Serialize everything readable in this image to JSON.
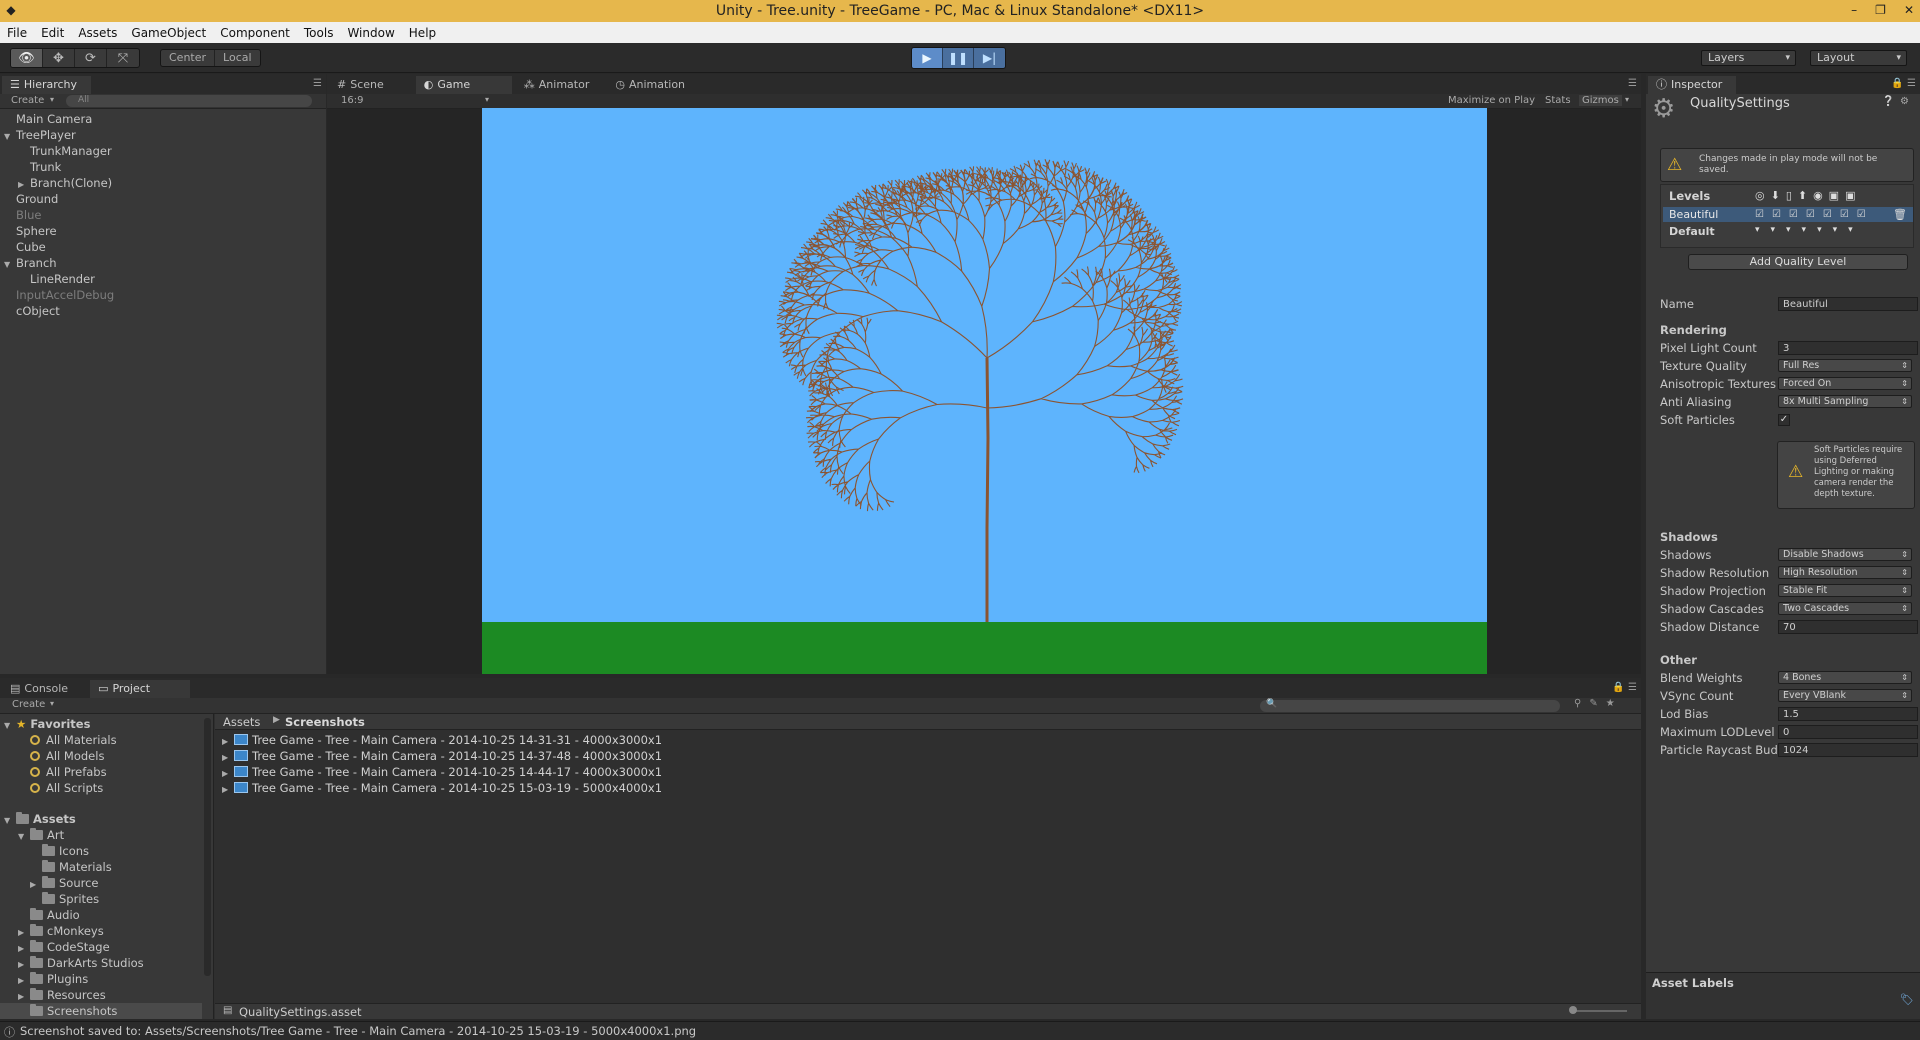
{
  "window": {
    "title": "Unity - Tree.unity - TreeGame - PC, Mac & Linux Standalone* <DX11>"
  },
  "menu": [
    "File",
    "Edit",
    "Assets",
    "GameObject",
    "Component",
    "Tools",
    "Window",
    "Help"
  ],
  "toolbar": {
    "center_label": "Center",
    "local_label": "Local",
    "layers_label": "Layers",
    "layout_label": "Layout"
  },
  "hierarchy": {
    "tab_label": "Hierarchy",
    "create_label": "Create",
    "search_placeholder": "All",
    "items": [
      {
        "label": "Main Camera"
      },
      {
        "label": "TreePlayer"
      },
      {
        "label": "TrunkManager"
      },
      {
        "label": "Trunk"
      },
      {
        "label": "Branch(Clone)"
      },
      {
        "label": "Ground"
      },
      {
        "label": "Blue"
      },
      {
        "label": "Sphere"
      },
      {
        "label": "Cube"
      },
      {
        "label": "Branch"
      },
      {
        "label": "LineRender"
      },
      {
        "label": "InputAccelDebug"
      },
      {
        "label": "cObject"
      }
    ]
  },
  "scene_tabs": [
    {
      "label": "Scene"
    },
    {
      "label": "Game"
    },
    {
      "label": "Animator"
    },
    {
      "label": "Animation"
    }
  ],
  "game_view": {
    "aspect": "16:9",
    "maximize_label": "Maximize on Play",
    "stats_label": "Stats",
    "gizmos_label": "Gizmos",
    "sky_color": "#5eb4fd",
    "ground_color": "#1c8a23",
    "branch_color": "#8b5431"
  },
  "inspector": {
    "tab_label": "Inspector",
    "title": "QualitySettings",
    "warning": "Changes made in play mode will not be saved.",
    "levels_label": "Levels",
    "level_name": "Beautiful",
    "default_label": "Default",
    "add_button": "Add Quality Level",
    "name_label": "Name",
    "name_value": "Beautiful",
    "rendering_header": "Rendering",
    "rendering": [
      {
        "label": "Pixel Light Count",
        "value": "3"
      },
      {
        "label": "Texture Quality",
        "value": "Full Res"
      },
      {
        "label": "Anisotropic Textures",
        "value": "Forced On"
      },
      {
        "label": "Anti Aliasing",
        "value": "8x Multi Sampling"
      },
      {
        "label": "Soft Particles",
        "value": "✓"
      }
    ],
    "soft_warning": "Soft Particles require using Deferred Lighting or making camera render the depth texture.",
    "shadows_header": "Shadows",
    "shadows": [
      {
        "label": "Shadows",
        "value": "Disable Shadows"
      },
      {
        "label": "Shadow Resolution",
        "value": "High Resolution"
      },
      {
        "label": "Shadow Projection",
        "value": "Stable Fit"
      },
      {
        "label": "Shadow Cascades",
        "value": "Two Cascades"
      },
      {
        "label": "Shadow Distance",
        "value": "70"
      }
    ],
    "other_header": "Other",
    "other": [
      {
        "label": "Blend Weights",
        "value": "4 Bones"
      },
      {
        "label": "VSync Count",
        "value": "Every VBlank"
      },
      {
        "label": "Lod Bias",
        "value": "1.5"
      },
      {
        "label": "Maximum LODLevel",
        "value": "0"
      },
      {
        "label": "Particle Raycast Bud",
        "value": "1024"
      }
    ],
    "asset_labels": "Asset Labels"
  },
  "bottom_tabs": [
    {
      "label": "Console"
    },
    {
      "label": "Project"
    }
  ],
  "project": {
    "create_label": "Create",
    "favorites_label": "Favorites",
    "favorites": [
      "All Materials",
      "All Models",
      "All Prefabs",
      "All Scripts"
    ],
    "assets_label": "Assets",
    "tree": [
      {
        "label": "Art"
      },
      {
        "label": "Icons"
      },
      {
        "label": "Materials"
      },
      {
        "label": "Source"
      },
      {
        "label": "Sprites"
      },
      {
        "label": "Audio"
      },
      {
        "label": "cMonkeys"
      },
      {
        "label": "CodeStage"
      },
      {
        "label": "DarkArts Studios"
      },
      {
        "label": "Plugins"
      },
      {
        "label": "Resources"
      },
      {
        "label": "Screenshots"
      }
    ],
    "breadcrumb_root": "Assets",
    "breadcrumb_leaf": "Screenshots",
    "files": [
      "Tree Game - Tree - Main Camera - 2014-10-25 14-31-31 - 4000x3000x1",
      "Tree Game - Tree - Main Camera - 2014-10-25 14-37-48 - 4000x3000x1",
      "Tree Game - Tree - Main Camera - 2014-10-25 14-44-17 - 4000x3000x1",
      "Tree Game - Tree - Main Camera - 2014-10-25 15-03-19 - 5000x4000x1"
    ],
    "selected_asset": "QualitySettings.asset"
  },
  "status": "Screenshot saved to: Assets/Screenshots/Tree Game - Tree - Main Camera - 2014-10-25 15-03-19 - 5000x4000x1.png"
}
